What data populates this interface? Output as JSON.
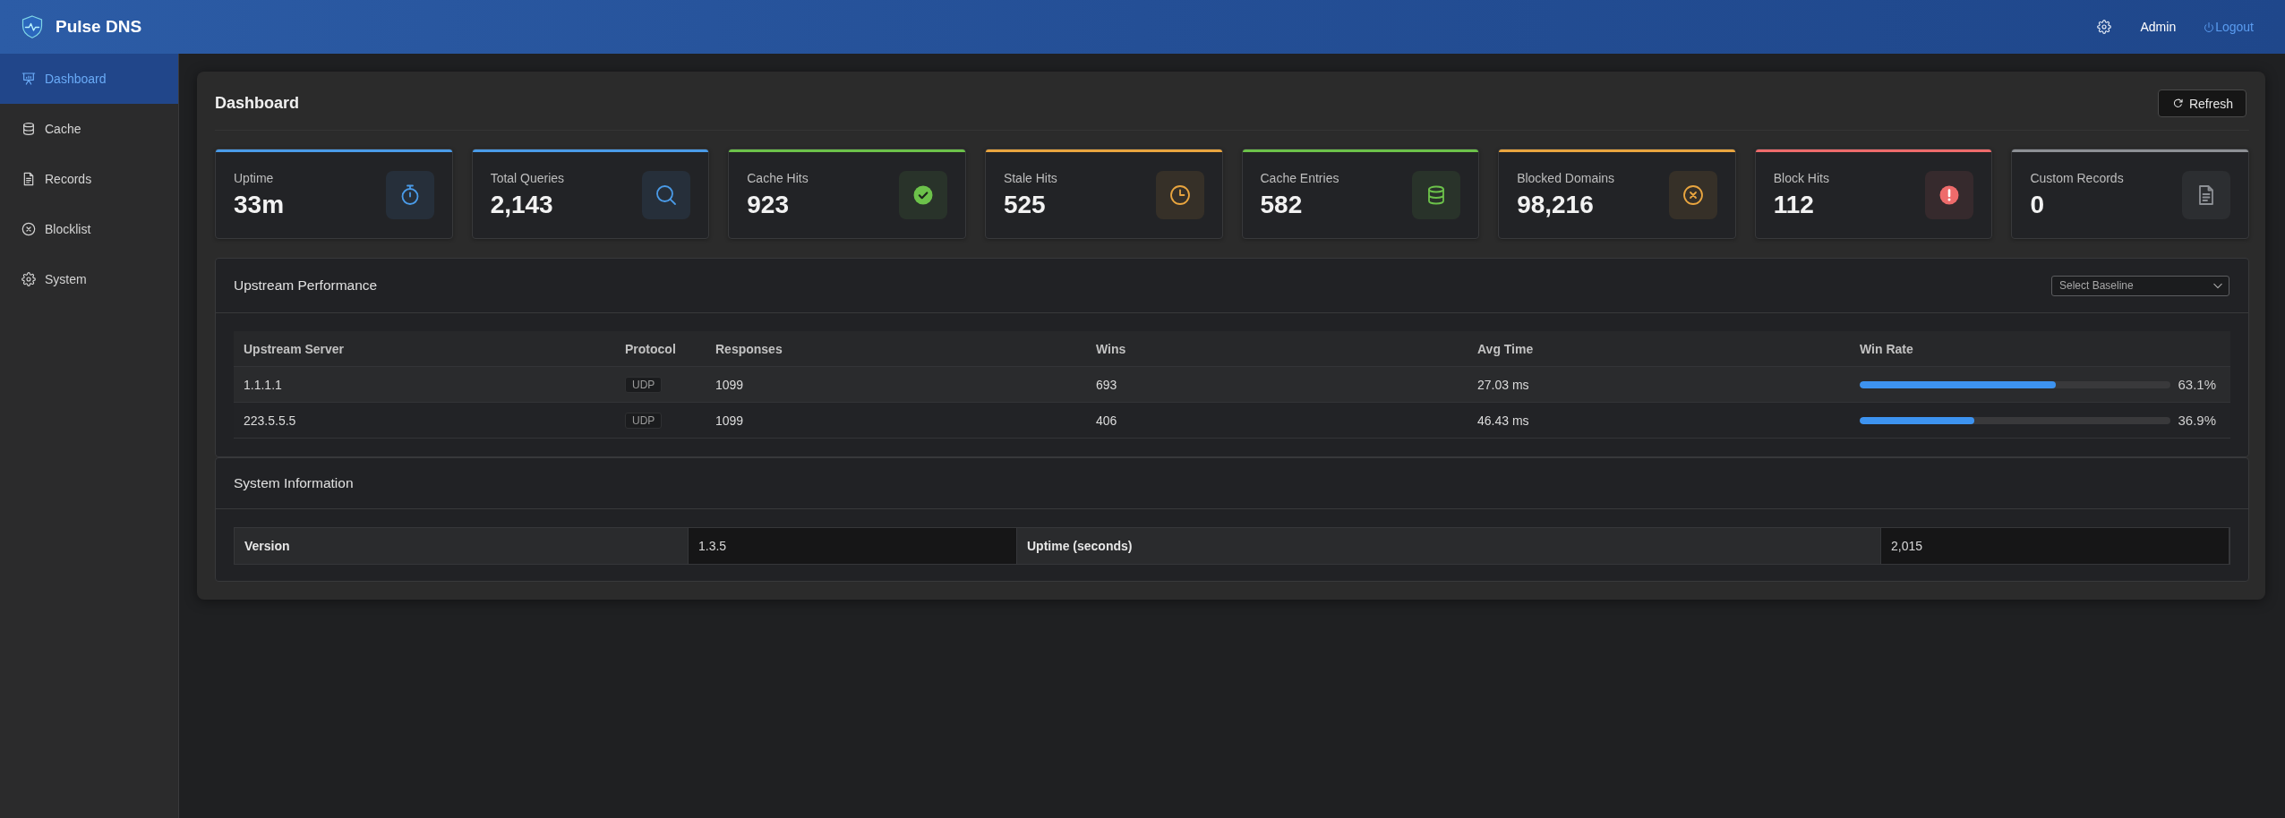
{
  "app": {
    "title": "Pulse DNS",
    "user": "Admin",
    "logout": "Logout"
  },
  "sidebar": {
    "items": [
      {
        "label": "Dashboard",
        "selected": true
      },
      {
        "label": "Cache",
        "selected": false
      },
      {
        "label": "Records",
        "selected": false
      },
      {
        "label": "Blocklist",
        "selected": false
      },
      {
        "label": "System",
        "selected": false
      }
    ]
  },
  "page": {
    "title": "Dashboard",
    "refresh": "Refresh"
  },
  "stats": [
    {
      "label": "Uptime",
      "value": "33m",
      "color": "#4a9be8"
    },
    {
      "label": "Total Queries",
      "value": "2,143",
      "color": "#4a9be8"
    },
    {
      "label": "Cache Hits",
      "value": "923",
      "color": "#6cc24a"
    },
    {
      "label": "Stale Hits",
      "value": "525",
      "color": "#e9a53f"
    },
    {
      "label": "Cache Entries",
      "value": "582",
      "color": "#6cc24a"
    },
    {
      "label": "Blocked Domains",
      "value": "98,216",
      "color": "#e9a53f"
    },
    {
      "label": "Block Hits",
      "value": "112",
      "color": "#ee6b6b"
    },
    {
      "label": "Custom Records",
      "value": "0",
      "color": "#8d9095"
    }
  ],
  "upstream": {
    "title": "Upstream Performance",
    "baseline_select": "Select Baseline",
    "columns": [
      "Upstream Server",
      "Protocol",
      "Responses",
      "Wins",
      "Avg Time",
      "Win Rate"
    ],
    "rows": [
      {
        "server": "1.1.1.1",
        "protocol": "UDP",
        "responses": "1099",
        "wins": "693",
        "avg_time": "27.03 ms",
        "level": 0.631,
        "win_rate": "63.1%"
      },
      {
        "server": "223.5.5.5",
        "protocol": "UDP",
        "responses": "1099",
        "wins": "406",
        "avg_time": "46.43 ms",
        "level": 0.369,
        "win_rate": "36.9%"
      }
    ]
  },
  "system_info": {
    "title": "System Information",
    "fields": [
      {
        "label": "Version",
        "value": "1.3.5"
      },
      {
        "label": "Uptime (seconds)",
        "value": "2,015"
      }
    ]
  }
}
